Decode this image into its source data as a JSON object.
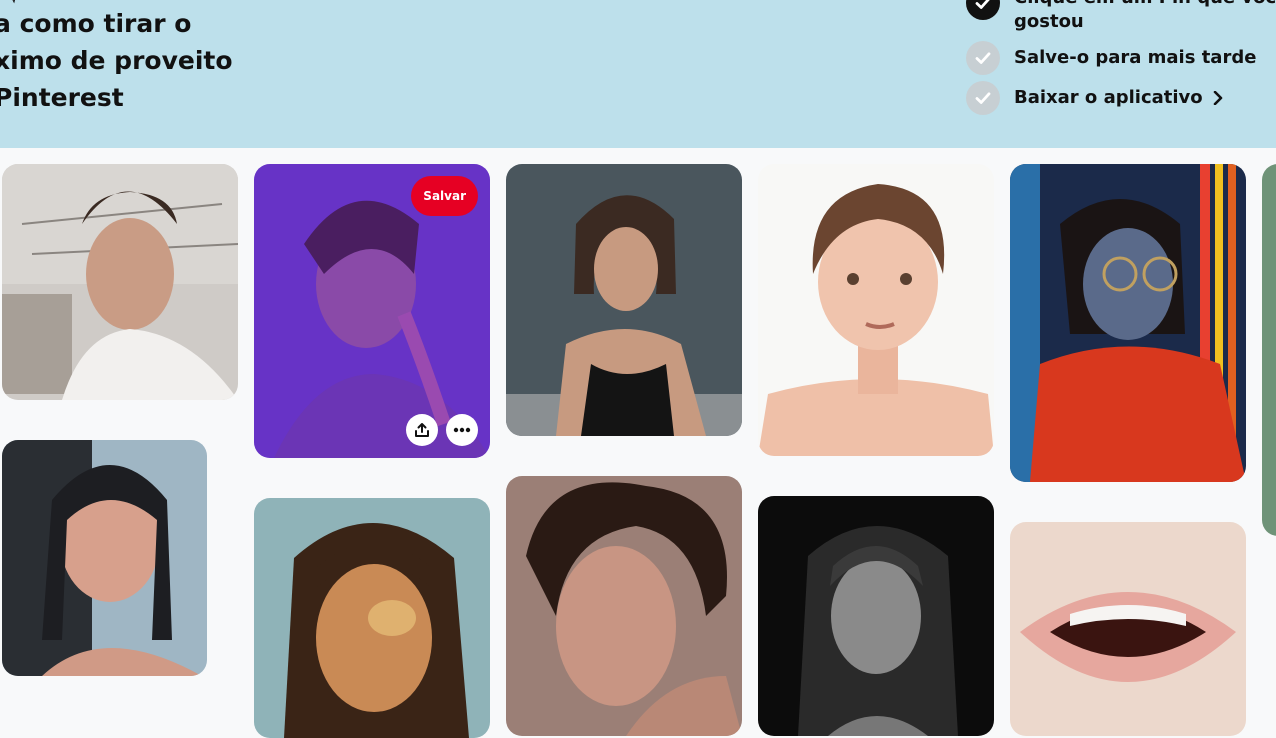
{
  "banner": {
    "title_lines": [
      "a como tirar o",
      "ximo de proveito",
      "Pinterest"
    ],
    "steps": [
      {
        "label_lines": [
          "Clique em um Pin que você",
          "gostou"
        ],
        "state": "done"
      },
      {
        "label": "Salve-o para mais tarde",
        "state": "todo"
      },
      {
        "label": "Baixar o aplicativo",
        "state": "todo"
      }
    ],
    "background_color": "#bde0eb"
  },
  "pins": {
    "save_label": "Salvar",
    "items": [
      {
        "name": "woman-messy-bun-white-top"
      },
      {
        "name": "woman-purple-neon-portrait",
        "hovered": true,
        "icons": [
          "share-icon",
          "more-options-icon"
        ]
      },
      {
        "name": "painted-woman-black-tank-top"
      },
      {
        "name": "woman-short-hair-illustration"
      },
      {
        "name": "woman-glasses-neon-lights"
      },
      {
        "name": "woman-long-black-hair"
      },
      {
        "name": "woman-bangs-painted-portrait"
      },
      {
        "name": "woman-curly-hair-profile"
      },
      {
        "name": "woman-black-and-white-portrait"
      },
      {
        "name": "lips-close-up"
      }
    ]
  },
  "colors": {
    "save_button": "#e60023",
    "page_bg": "#f8f9fa"
  }
}
